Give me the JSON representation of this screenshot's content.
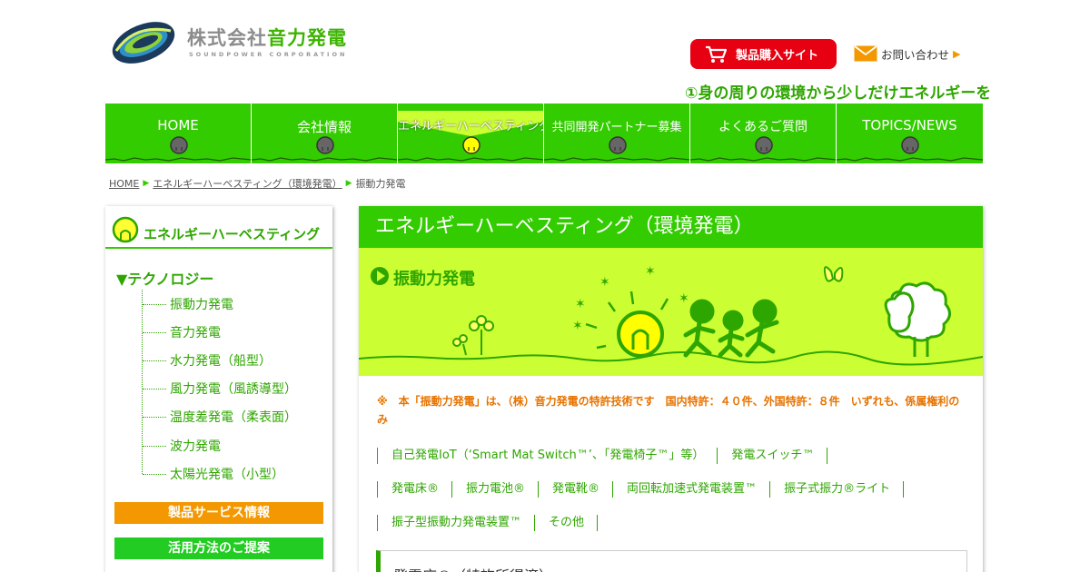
{
  "header": {
    "company_jp_prefix": "株式会社",
    "company_jp_accent": "音力発電",
    "company_en": "SOUNDPOWER CORPORATION",
    "shop_button": "製品購入サイト",
    "contact_link": "お問い合わせ",
    "marquee": "①身の周りの環境から少しだけエネルギーを"
  },
  "nav": {
    "items": [
      {
        "label": "HOME"
      },
      {
        "label": "会社情報"
      },
      {
        "label": "エネルギーハーベスティング"
      },
      {
        "label": "共同開発パートナー募集"
      },
      {
        "label": "よくあるご質問"
      },
      {
        "label": "TOPICS/NEWS"
      }
    ],
    "active_index": 2
  },
  "breadcrumb": {
    "items": [
      "HOME",
      "エネルギーハーベスティング（環境発電）",
      "振動力発電"
    ]
  },
  "sidebar": {
    "heading": "エネルギーハーベスティング",
    "tech_title": "▼テクノロジー",
    "tech_items": [
      "振動力発電",
      "音力発電",
      "水力発電（船型）",
      "風力発電（風誘導型）",
      "温度差発電（柔表面）",
      "波力発電",
      "太陽光発電（小型）"
    ],
    "btn_products": "製品サービス情報",
    "btn_usage": "活用方法のご提案"
  },
  "main": {
    "title": "エネルギーハーベスティング（環境発電）",
    "banner_title": "振動力発電",
    "notice": "※　本「振動力発電」は、（株）音力発電の特許技術です　国内特許：４０件、外国特許：８件　いずれも、係属権利のみ",
    "links_row1": [
      "自己発電IoT（‘Smart Mat Switch™’、「発電椅子™」等）",
      "発電スイッチ™"
    ],
    "links_row2": [
      "発電床®",
      "振力電池®",
      "発電靴®",
      "両回転加速式発電装置™",
      "振子式振力®ライト"
    ],
    "links_row3": [
      "振子型振動力発電装置™",
      "その他"
    ],
    "subbox_text": "発電床®（特許所得済）"
  },
  "colors": {
    "brand_green": "#33cc00",
    "text_green": "#2ea600",
    "banner_bg": "#ccff33",
    "shop_red": "#e60012",
    "accent_orange": "#f39800"
  }
}
